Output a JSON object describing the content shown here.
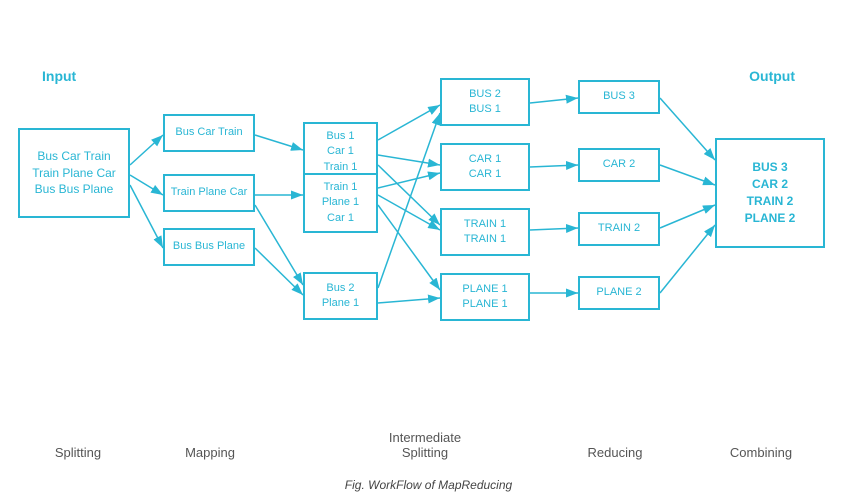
{
  "title": "Fig. WorkFlow of MapReducing",
  "labels": {
    "input": "Input",
    "output": "Output",
    "splitting": "Splitting",
    "mapping": "Mapping",
    "intermediate_splitting": "Intermediate\nSplitting",
    "reducing": "Reducing",
    "combining": "Combining"
  },
  "boxes": {
    "input": "Bus Car Train\nTrain Plane Car\nBus Bus Plane",
    "map1": "Bus Car Train",
    "map2": "Train Plane Car",
    "map3": "Bus Bus Plane",
    "split1": "Bus 1\nCar 1\nTrain 1",
    "split2": "Train 1\nPlane 1\nCar 1",
    "split3": "Bus 2\nPlane 1",
    "inter1": "BUS 2\nBUS 1",
    "inter2": "CAR 1\nCAR 1",
    "inter3": "TRAIN 1\nTRAIN 1",
    "inter4": "PLANE 1\nPLANE 1",
    "reduce1": "BUS 3",
    "reduce2": "CAR  2",
    "reduce3": "TRAIN 2",
    "reduce4": "PLANE 2",
    "output": "BUS 3\nCAR 2\nTRAIN 2\nPLANE 2"
  }
}
